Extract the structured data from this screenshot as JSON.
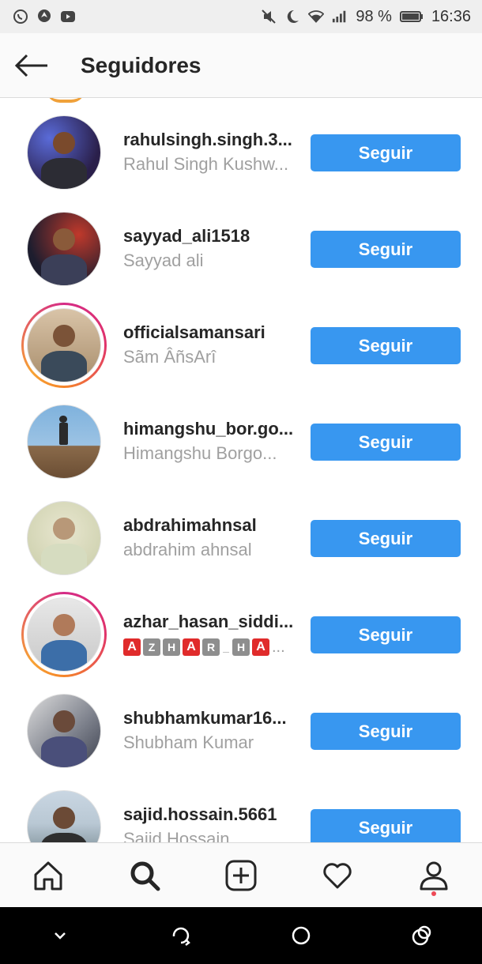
{
  "status_bar": {
    "battery_percent": "98 %",
    "time": "16:36",
    "left_icons": [
      "whatsapp-icon",
      "location-icon",
      "youtube-icon"
    ],
    "right_icons": [
      "mute-icon",
      "moon-icon",
      "wifi-icon",
      "signal-icon",
      "battery-icon"
    ]
  },
  "header": {
    "title": "Seguidores",
    "back_icon": "arrow-left-icon"
  },
  "button_label": "Seguir",
  "colors": {
    "accent": "#3897f0",
    "story_ring_start": "#d52b86",
    "story_ring_end": "#f58529",
    "notification_dot": "#ed4956"
  },
  "followers": [
    {
      "username": "rahulsingh.singh.3...",
      "name": "Rahul Singh Kushw...",
      "story_ring": false,
      "button": "Seguir"
    },
    {
      "username": "sayyad_ali1518",
      "name": "Sayyad ali",
      "story_ring": false,
      "button": "Seguir"
    },
    {
      "username": "officialsamansari",
      "name": "Sãm ÂñsArî",
      "story_ring": true,
      "button": "Seguir"
    },
    {
      "username": "himangshu_bor.go...",
      "name": "Himangshu Borgo...",
      "story_ring": false,
      "button": "Seguir"
    },
    {
      "username": "abdrahimahnsal",
      "name": "abdrahim ahnsal",
      "story_ring": false,
      "button": "Seguir"
    },
    {
      "username": "azhar_hasan_siddi...",
      "name": "AZHAR_HA...",
      "name_letters": [
        "A",
        "Z",
        "H",
        "A",
        "R",
        "_",
        "H",
        "A"
      ],
      "name_suffix": "...",
      "story_ring": true,
      "button": "Seguir"
    },
    {
      "username": "shubhamkumar16...",
      "name": "Shubham Kumar",
      "story_ring": false,
      "button": "Seguir"
    },
    {
      "username": "sajid.hossain.5661",
      "name": "Sajid Hossain",
      "story_ring": false,
      "button": "Seguir"
    }
  ],
  "bottom_nav": {
    "items": [
      "home-icon",
      "search-icon",
      "add-post-icon",
      "activity-heart-icon",
      "profile-icon"
    ],
    "active": "search-icon"
  },
  "system_nav": {
    "items": [
      "hide-keyboard-icon",
      "rotate-icon",
      "home-circle-icon",
      "recents-icon"
    ]
  }
}
